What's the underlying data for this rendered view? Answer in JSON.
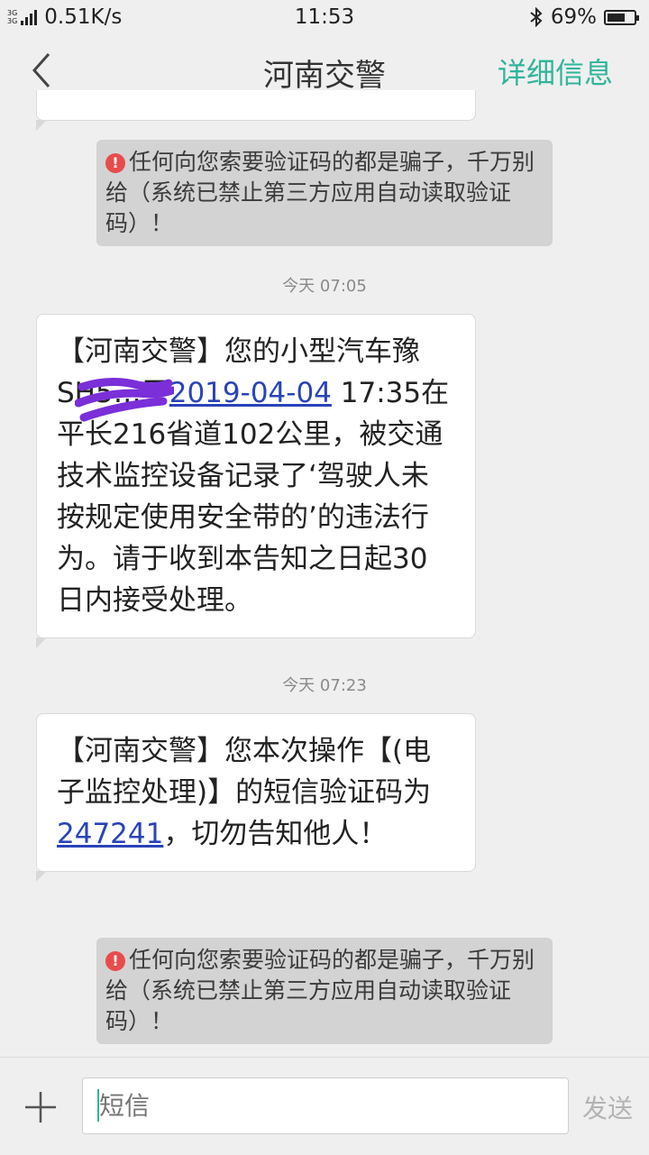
{
  "status_bar": {
    "network_top": "3G",
    "network_bottom": "3G",
    "speed": "0.51K/s",
    "time": "11:53",
    "battery": "69%",
    "battery_level": 0.69
  },
  "header": {
    "title": "河南交警",
    "detail_label": "详细信息"
  },
  "messages": [
    {
      "type": "warning",
      "text": "任何向您索要验证码的都是骗子，千万别给（系统已禁止第三方应用自动读取验证码）！"
    },
    {
      "type": "timestamp",
      "text": "今天  07:05"
    },
    {
      "type": "sms",
      "before": "【河南交警】您的小型汽车豫SH",
      "redacted": "5…",
      "middle": "于",
      "link": "2019-04-04",
      "after": " 17:35在平长216省道102公里，被交通技术监控设备记录了‘驾驶人未按规定使用安全带的’的违法行为。请于收到本告知之日起30日内接受处理。"
    },
    {
      "type": "timestamp",
      "text": "今天  07:23"
    },
    {
      "type": "sms",
      "before": "【河南交警】您本次操作【(电子监控处理)】的短信验证码为",
      "link": "247241",
      "after": "，切勿告知他人！"
    },
    {
      "type": "warning",
      "text": "任何向您索要验证码的都是骗子，千万别给（系统已禁止第三方应用自动读取验证码）！"
    }
  ],
  "composer": {
    "placeholder": "短信",
    "send_label": "发送"
  },
  "colors": {
    "accent": "#2fb59b",
    "link": "#2a43b8",
    "warning_icon": "#e74c4c"
  }
}
